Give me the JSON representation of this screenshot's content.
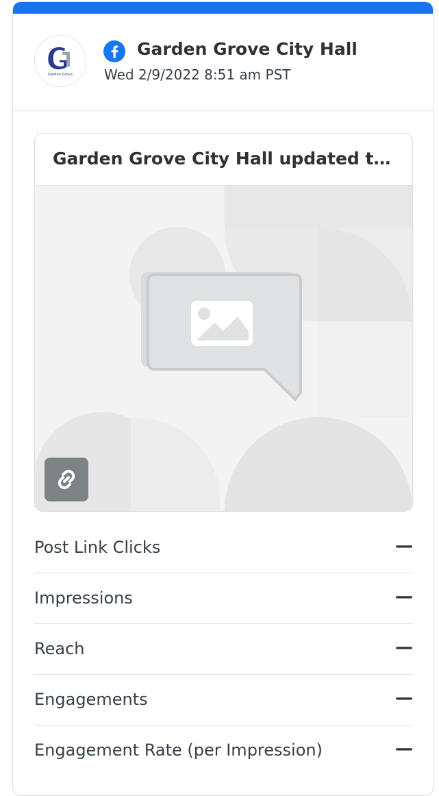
{
  "account": {
    "name": "Garden Grove City Hall",
    "timestamp": "Wed 2/9/2022 8:51 am PST",
    "network_icon": "facebook-icon",
    "avatar_text": "Garden Grove"
  },
  "post": {
    "title": "Garden Grove City Hall updated their cover photo.",
    "image_icon": "image-placeholder-icon",
    "link_icon": "link-icon"
  },
  "metrics": [
    {
      "label": "Post Link Clicks",
      "value": "—"
    },
    {
      "label": "Impressions",
      "value": "—"
    },
    {
      "label": "Reach",
      "value": "—"
    },
    {
      "label": "Engagements",
      "value": "—"
    },
    {
      "label": "Engagement Rate (per Impression)",
      "value": "—"
    }
  ],
  "colors": {
    "accent": "#1a73e8",
    "facebook": "#1877f2",
    "text": "#364049"
  }
}
